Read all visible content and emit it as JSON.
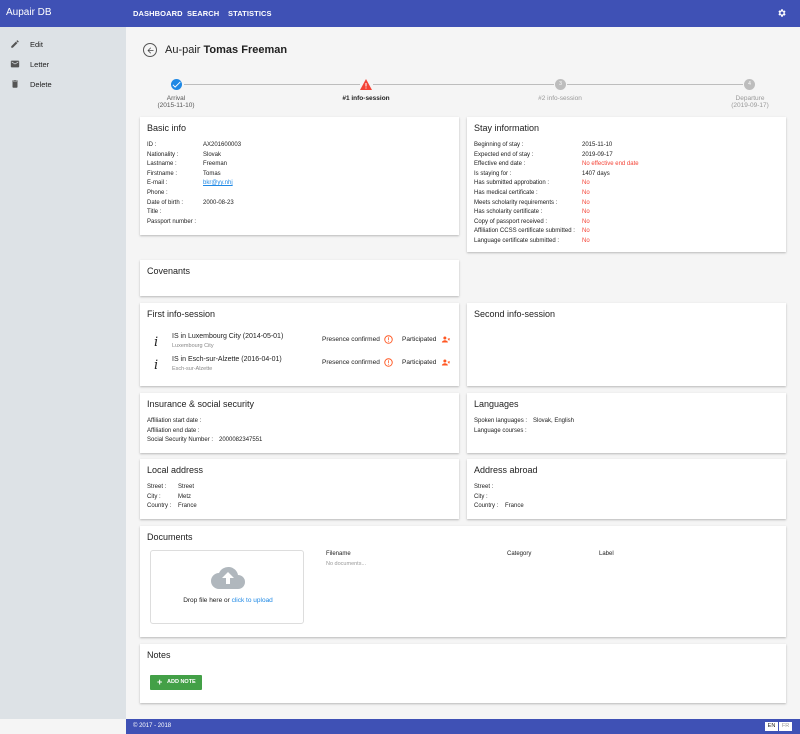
{
  "app": {
    "title": "Aupair DB"
  },
  "nav": {
    "dashboard": "DASHBOARD",
    "search": "SEARCH",
    "statistics": "STATISTICS"
  },
  "sidebar": {
    "items": [
      {
        "label": "Edit",
        "icon": "pencil-icon"
      },
      {
        "label": "Letter",
        "icon": "envelope-icon"
      },
      {
        "label": "Delete",
        "icon": "trash-icon"
      }
    ]
  },
  "header": {
    "prefix": "Au-pair",
    "name": "Tomas Freeman"
  },
  "steps": [
    {
      "label": "Arrival",
      "date": "(2015-11-10)",
      "state": "done",
      "num": ""
    },
    {
      "label": "#1 info-session",
      "date": "",
      "state": "warning",
      "num": ""
    },
    {
      "label": "#2 info-session",
      "date": "",
      "state": "pending",
      "num": "3"
    },
    {
      "label": "Departure",
      "date": "(2019-09-17)",
      "state": "pending",
      "num": "4"
    }
  ],
  "basic_info": {
    "title": "Basic info",
    "rows": [
      {
        "k": "ID :",
        "v": "AX201600003"
      },
      {
        "k": "Nationality :",
        "v": "Slovak"
      },
      {
        "k": "Lastname :",
        "v": "Freeman"
      },
      {
        "k": "Firstname :",
        "v": "Tomas"
      },
      {
        "k": "E-mail :",
        "v": "bkr@yy.nhj"
      },
      {
        "k": "Phone :",
        "v": ""
      },
      {
        "k": "Date of birth :",
        "v": "2000-08-23"
      },
      {
        "k": "Title :",
        "v": ""
      },
      {
        "k": "Passport number :",
        "v": ""
      }
    ]
  },
  "stay_info": {
    "title": "Stay information",
    "rows": [
      {
        "k": "Beginning of stay :",
        "v": "2015-11-10"
      },
      {
        "k": "Expected end of stay :",
        "v": "2019-09-17"
      },
      {
        "k": "Effective end date :",
        "v": "No effective end date"
      },
      {
        "k": "Is staying for :",
        "v": "1407 days"
      },
      {
        "k": "Has submitted approbation :",
        "v": "No"
      },
      {
        "k": "Has medical certificate :",
        "v": "No"
      },
      {
        "k": "Meets scholarity requirements :",
        "v": "No"
      },
      {
        "k": "Has scholarity certificate :",
        "v": "No"
      },
      {
        "k": "Copy of passport received :",
        "v": "No"
      },
      {
        "k": "Affiliation CCSS certificate submitted :",
        "v": "No"
      },
      {
        "k": "Language certificate submitted :",
        "v": "No"
      }
    ]
  },
  "covenants": {
    "title": "Covenants"
  },
  "first_session": {
    "title": "First info-session",
    "items": [
      {
        "title": "IS in Luxembourg City (2014-05-01)",
        "sub": "Luxembourg City",
        "presence": "Presence confirmed",
        "participated": "Participated"
      },
      {
        "title": "IS in Esch-sur-Alzette (2016-04-01)",
        "sub": "Esch-sur-Alzette",
        "presence": "Presence confirmed",
        "participated": "Participated"
      }
    ]
  },
  "second_session": {
    "title": "Second info-session"
  },
  "insurance": {
    "title": "Insurance & social security",
    "rows": [
      {
        "k": "Affiliation start date :",
        "v": ""
      },
      {
        "k": "Affiliation end date :",
        "v": ""
      },
      {
        "k": "Social Security Number :",
        "v": "2000082347551"
      }
    ]
  },
  "languages": {
    "title": "Languages",
    "rows": [
      {
        "k": "Spoken languages :",
        "v": "Slovak, English"
      },
      {
        "k": "Language courses :",
        "v": ""
      }
    ]
  },
  "local_address": {
    "title": "Local address",
    "rows": [
      {
        "k": "Street :",
        "v": "Street"
      },
      {
        "k": "City :",
        "v": "Metz"
      },
      {
        "k": "Country :",
        "v": "France"
      }
    ]
  },
  "address_abroad": {
    "title": "Address abroad",
    "rows": [
      {
        "k": "Street :",
        "v": ""
      },
      {
        "k": "City :",
        "v": ""
      },
      {
        "k": "Country :",
        "v": "France"
      }
    ]
  },
  "documents": {
    "title": "Documents",
    "drop_text": "Drop file here or",
    "upload_link": "click to upload",
    "columns": [
      "Filename",
      "Category",
      "Label"
    ],
    "empty": "No documents..."
  },
  "notes": {
    "title": "Notes",
    "add_label": "ADD NOTE"
  },
  "footer": {
    "copyright": "© 2017 - 2018",
    "lang_en": "EN",
    "lang_fr": "FR"
  },
  "colors": {
    "primary": "#3f51b5",
    "sidebar": "#dde2e6",
    "red": "#f44336",
    "link": "#1e88e5",
    "done": "#1e88e5",
    "warning": "#f44336",
    "orange": "#ff5722",
    "green": "#43a047"
  }
}
